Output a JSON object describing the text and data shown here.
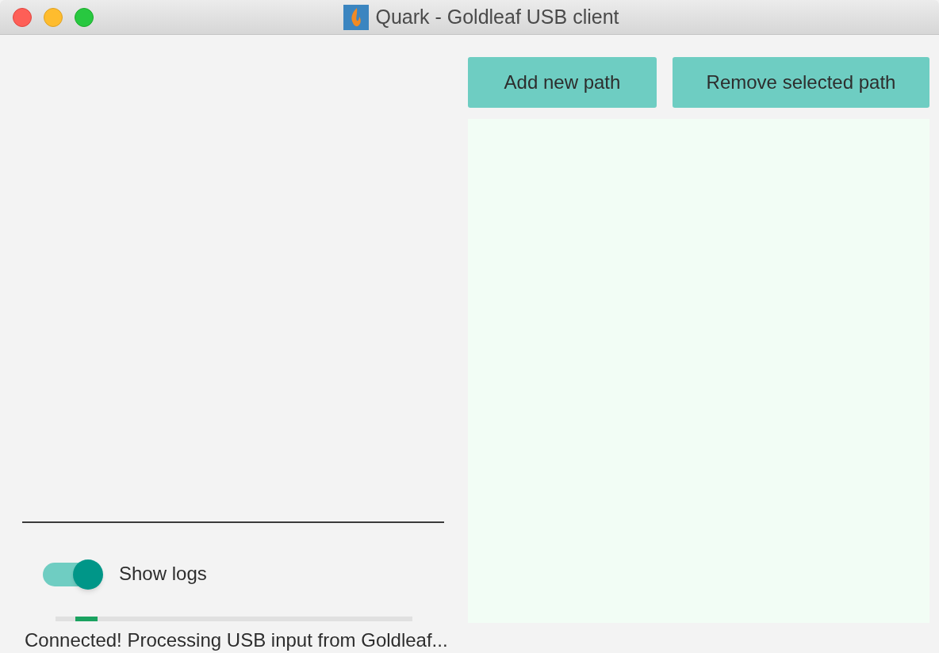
{
  "window": {
    "title": "Quark - Goldleaf USB client"
  },
  "toggle": {
    "label": "Show logs",
    "on": true
  },
  "progress_bar": {
    "indeterminate": true
  },
  "buttons": [
    {
      "label": "Add new path"
    },
    {
      "label": "Remove selected path"
    }
  ],
  "status_bar": "Connected! Processing USB input from Goldleaf..."
}
